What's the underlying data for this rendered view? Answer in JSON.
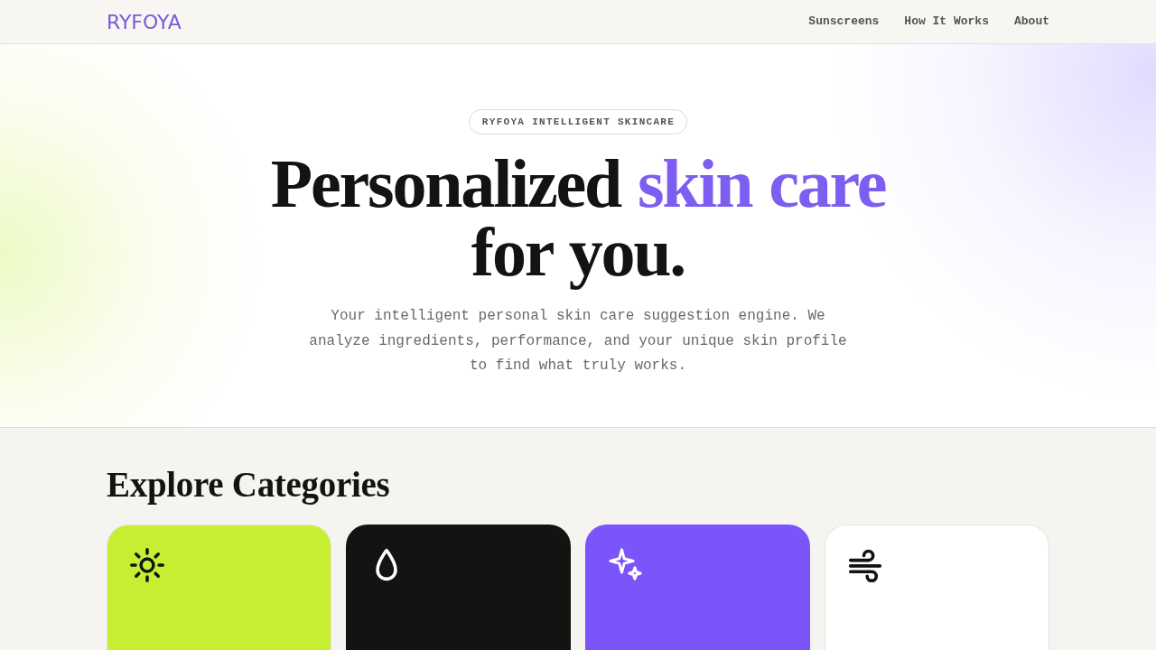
{
  "header": {
    "logo": "RYFOYA",
    "nav": [
      "Sunscreens",
      "How It Works",
      "About"
    ]
  },
  "hero": {
    "badge": "RYFOYA INTELLIGENT SKINCARE",
    "title": [
      {
        "text": "Personalized",
        "accent": false
      },
      {
        "text": "skin care",
        "accent": true
      },
      {
        "text": "for you.",
        "accent": false
      }
    ],
    "description": "Your intelligent personal skin care suggestion engine. We analyze ingredients, performance, and your unique skin profile to find what truly works."
  },
  "categories_section": {
    "heading": "Explore Categories",
    "cards": [
      {
        "color": "#c6ef34"
      },
      {
        "color": "#131411"
      },
      {
        "color": "#7b55fa"
      },
      {
        "color": "#ffffff"
      }
    ]
  }
}
